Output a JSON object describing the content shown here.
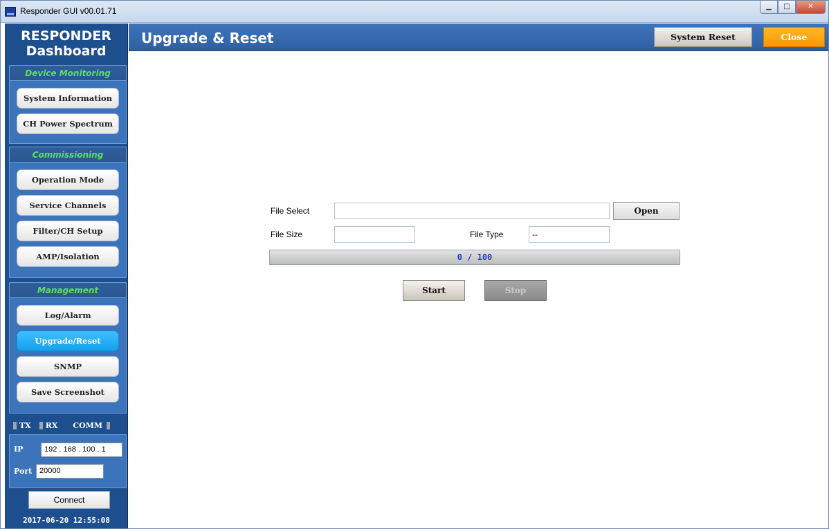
{
  "window": {
    "title": "Responder GUI v00.01.71",
    "icon": "app-icon"
  },
  "sidebar": {
    "brand_line1": "RESPONDER",
    "brand_line2": "Dashboard",
    "sections": [
      {
        "title": "Device Monitoring",
        "items": [
          {
            "label": "System Information"
          },
          {
            "label": "CH Power Spectrum"
          }
        ]
      },
      {
        "title": "Commissioning",
        "items": [
          {
            "label": "Operation Mode"
          },
          {
            "label": "Service Channels"
          },
          {
            "label": "Filter/CH Setup"
          },
          {
            "label": "AMP/Isolation"
          }
        ]
      },
      {
        "title": "Management",
        "items": [
          {
            "label": "Log/Alarm"
          },
          {
            "label": "Upgrade/Reset",
            "active": true
          },
          {
            "label": "SNMP"
          },
          {
            "label": "Save Screenshot"
          }
        ]
      }
    ],
    "indicators": {
      "tx": "TX",
      "rx": "RX",
      "comm": "COMM"
    },
    "connection": {
      "ip_label": "IP",
      "ip_value": "192 . 168 . 100 .  1",
      "port_label": "Port",
      "port_value": "20000",
      "connect_label": "Connect"
    },
    "datetime": "2017-06-20 12:55:08"
  },
  "header": {
    "title": "Upgrade & Reset",
    "system_reset_label": "System Reset",
    "close_label": "Close"
  },
  "main": {
    "file_select_label": "File Select",
    "file_select_value": "",
    "open_label": "Open",
    "file_size_label": "File Size",
    "file_size_value": "",
    "file_type_label": "File Type",
    "file_type_value": "--",
    "progress_text": "0 / 100",
    "progress_fraction": 0,
    "start_label": "Start",
    "stop_label": "Stop"
  },
  "colors": {
    "sidebar_bg": "#1d4f8e",
    "section_title": "#5de05d",
    "active_button": "#14a0ec",
    "close_button": "#ff9800",
    "progress_text": "#1b3ccf"
  }
}
